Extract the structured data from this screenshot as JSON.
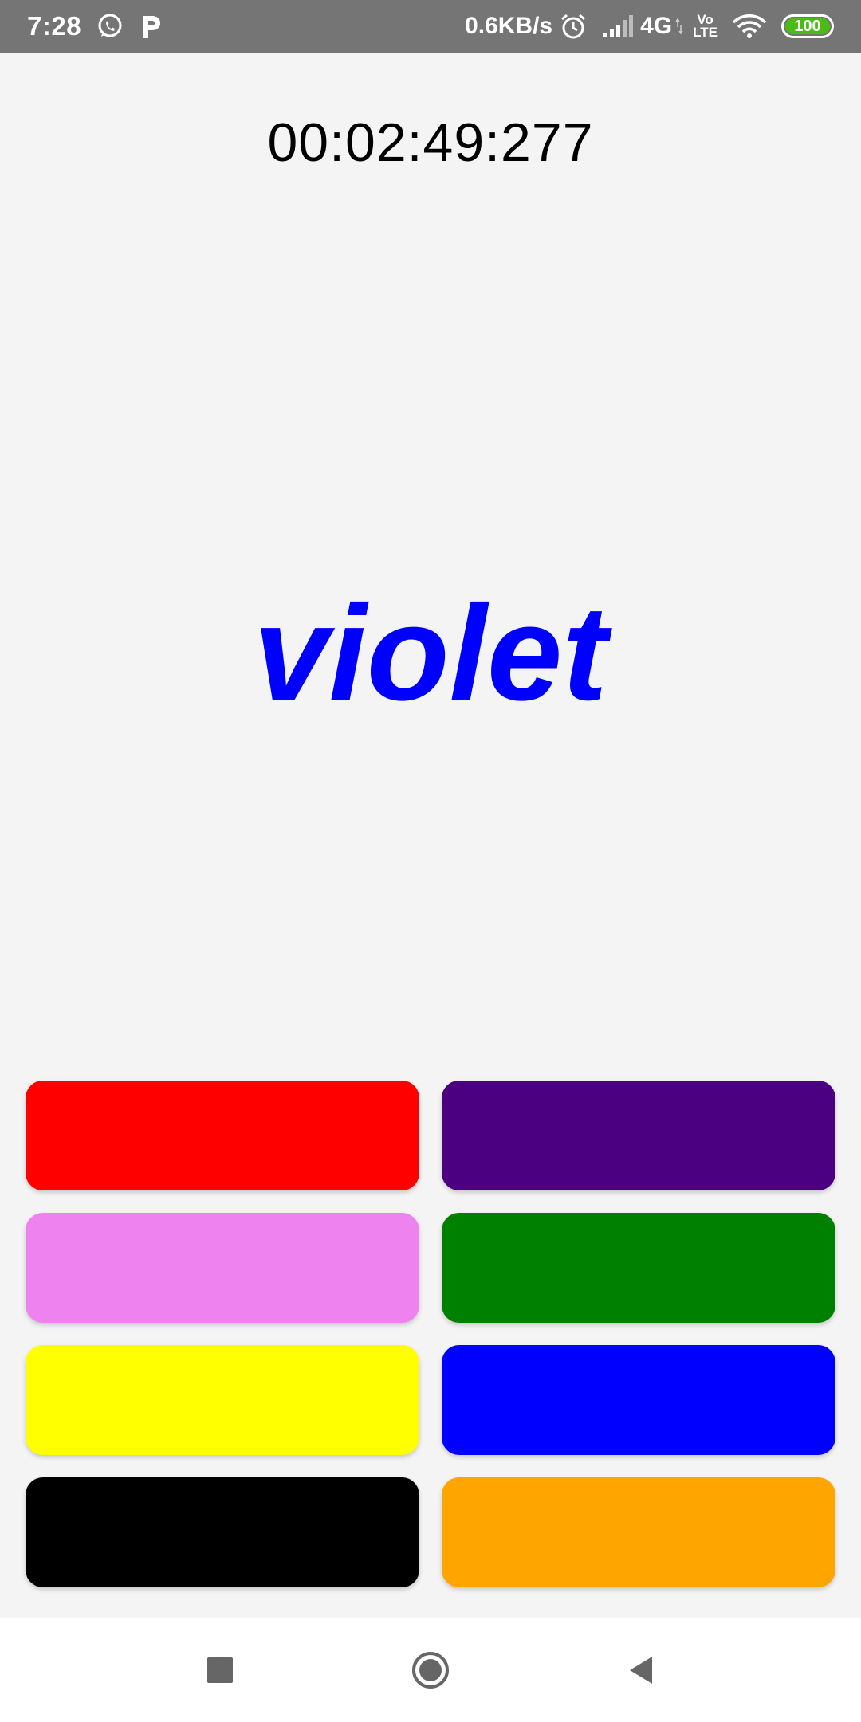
{
  "status_bar": {
    "time": "7:28",
    "network_speed": "0.6KB/s",
    "network_type": "4G",
    "volte_top": "Vo",
    "volte_bottom": "LTE",
    "battery_level": "100",
    "battery_fraction": 1.0,
    "icons": [
      "whatsapp-icon",
      "p-app-icon",
      "alarm-icon",
      "signal-icon",
      "wifi-icon",
      "battery-icon"
    ]
  },
  "game": {
    "timer": "00:02:49:277",
    "word": "violet",
    "word_color": "#0000ff",
    "color_buttons": [
      {
        "name": "red",
        "color": "#ff0000"
      },
      {
        "name": "indigo",
        "color": "#4b0082"
      },
      {
        "name": "violet",
        "color": "#ee82ee"
      },
      {
        "name": "green",
        "color": "#008000"
      },
      {
        "name": "yellow",
        "color": "#ffff00"
      },
      {
        "name": "blue",
        "color": "#0000ff"
      },
      {
        "name": "black",
        "color": "#000000"
      },
      {
        "name": "orange",
        "color": "#ffa500"
      }
    ]
  },
  "nav_bar": {
    "icons": [
      "recents-square-icon",
      "home-circle-icon",
      "back-triangle-icon"
    ]
  }
}
